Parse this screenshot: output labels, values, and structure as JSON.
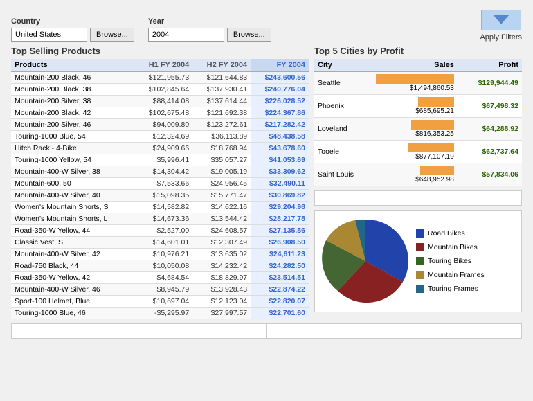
{
  "filters": {
    "country_label": "Country",
    "country_value": "United States",
    "browse_label": "Browse...",
    "year_label": "Year",
    "year_value": "2004",
    "apply_label": "Apply Filters"
  },
  "left_panel": {
    "title": "Top Selling Products",
    "columns": [
      "Products",
      "H1 FY 2004",
      "H2 FY 2004",
      "FY 2004"
    ],
    "rows": [
      [
        "Mountain-200 Black, 46",
        "$121,955.73",
        "$121,644.83",
        "$243,600.56"
      ],
      [
        "Mountain-200 Black, 38",
        "$102,845.64",
        "$137,930.41",
        "$240,776.04"
      ],
      [
        "Mountain-200 Silver, 38",
        "$88,414.08",
        "$137,614.44",
        "$226,028.52"
      ],
      [
        "Mountain-200 Black, 42",
        "$102,675.48",
        "$121,692.38",
        "$224,367.86"
      ],
      [
        "Mountain-200 Silver, 46",
        "$94,009.80",
        "$123,272.61",
        "$217,282.42"
      ],
      [
        "Touring-1000 Blue, 54",
        "$12,324.69",
        "$36,113.89",
        "$48,438.58"
      ],
      [
        "Hitch Rack - 4-Bike",
        "$24,909.66",
        "$18,768.94",
        "$43,678.60"
      ],
      [
        "Touring-1000 Yellow, 54",
        "$5,996.41",
        "$35,057.27",
        "$41,053.69"
      ],
      [
        "Mountain-400-W Silver, 38",
        "$14,304.42",
        "$19,005.19",
        "$33,309.62"
      ],
      [
        "Mountain-600, 50",
        "$7,533.66",
        "$24,956.45",
        "$32,490.11"
      ],
      [
        "Mountain-400-W Silver, 40",
        "$15,098.35",
        "$15,771.47",
        "$30,869.82"
      ],
      [
        "Women's Mountain Shorts, S",
        "$14,582.82",
        "$14,622.16",
        "$29,204.98"
      ],
      [
        "Women's Mountain Shorts, L",
        "$14,673.36",
        "$13,544.42",
        "$28,217.78"
      ],
      [
        "Road-350-W Yellow, 44",
        "$2,527.00",
        "$24,608.57",
        "$27,135.56"
      ],
      [
        "Classic Vest, S",
        "$14,601.01",
        "$12,307.49",
        "$26,908.50"
      ],
      [
        "Mountain-400-W Silver, 42",
        "$10,976.21",
        "$13,635.02",
        "$24,611.23"
      ],
      [
        "Road-750 Black, 44",
        "$10,050.08",
        "$14,232.42",
        "$24,282.50"
      ],
      [
        "Road-350-W Yellow, 42",
        "$4,684.54",
        "$18,829.97",
        "$23,514.51"
      ],
      [
        "Mountain-400-W Silver, 46",
        "$8,945.79",
        "$13,928.43",
        "$22,874.22"
      ],
      [
        "Sport-100 Helmet, Blue",
        "$10,697.04",
        "$12,123.04",
        "$22,820.07"
      ],
      [
        "Touring-1000 Blue, 46",
        "-$5,295.97",
        "$27,997.57",
        "$22,701.60"
      ]
    ]
  },
  "right_panel": {
    "cities_title": "Top 5 Cities by Profit",
    "cities_columns": [
      "City",
      "Sales",
      "Profit"
    ],
    "cities": [
      {
        "name": "Seattle",
        "sales": "$1,494,860.53",
        "profit": "$129,944.49",
        "bar_pct": 100,
        "bar_color": "#f0a040"
      },
      {
        "name": "Phoenix",
        "sales": "$685,695.21",
        "profit": "$67,498.32",
        "bar_pct": 46,
        "bar_color": "#f0a040"
      },
      {
        "name": "Loveland",
        "sales": "$816,353.25",
        "profit": "$64,288.92",
        "bar_pct": 55,
        "bar_color": "#f0a040"
      },
      {
        "name": "Tooele",
        "sales": "$877,107.19",
        "profit": "$62,737.64",
        "bar_pct": 59,
        "bar_color": "#f0a040"
      },
      {
        "name": "Saint Louis",
        "sales": "$648,952.98",
        "profit": "$57,834.06",
        "bar_pct": 43,
        "bar_color": "#f0a040"
      }
    ],
    "pie_legend": [
      {
        "label": "Road Bikes",
        "color": "#2244aa"
      },
      {
        "label": "Mountain Bikes",
        "color": "#882222"
      },
      {
        "label": "Touring Bikes",
        "color": "#336622"
      },
      {
        "label": "Mountain Frames",
        "color": "#aa8833"
      },
      {
        "label": "Touring Frames",
        "color": "#226688"
      }
    ]
  }
}
